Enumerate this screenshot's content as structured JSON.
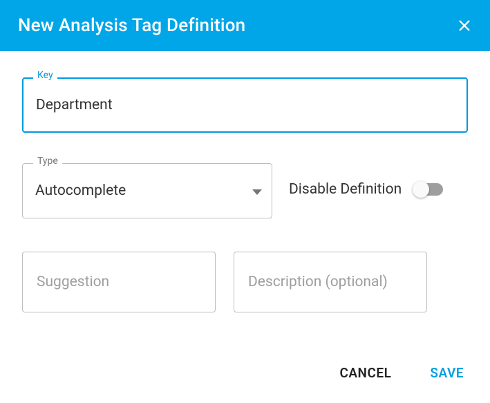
{
  "header": {
    "title": "New Analysis Tag Definition"
  },
  "form": {
    "key": {
      "label": "Key",
      "value": "Department"
    },
    "type": {
      "label": "Type",
      "value": "Autocomplete"
    },
    "disable": {
      "label": "Disable Definition",
      "checked": false
    },
    "suggestion": {
      "placeholder": "Suggestion"
    },
    "description": {
      "placeholder": "Description (optional)"
    }
  },
  "actions": {
    "cancel": "CANCEL",
    "save": "SAVE"
  }
}
